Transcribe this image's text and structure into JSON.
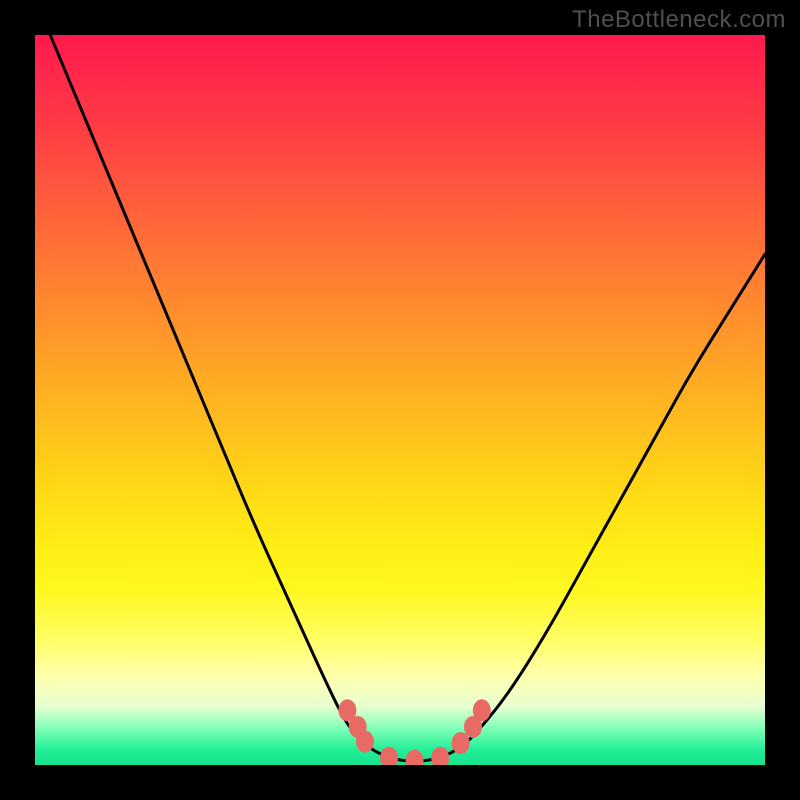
{
  "watermark": "TheBottleneck.com",
  "chart_data": {
    "type": "line",
    "title": "",
    "xlabel": "",
    "ylabel": "",
    "xlim": [
      0,
      1
    ],
    "ylim": [
      0,
      1
    ],
    "series": [
      {
        "name": "bottleneck-curve",
        "x": [
          0.0,
          0.05,
          0.1,
          0.15,
          0.2,
          0.25,
          0.3,
          0.35,
          0.4,
          0.43,
          0.46,
          0.5,
          0.54,
          0.58,
          0.61,
          0.65,
          0.7,
          0.75,
          0.8,
          0.85,
          0.9,
          0.95,
          1.0
        ],
        "y": [
          1.05,
          0.93,
          0.81,
          0.69,
          0.57,
          0.45,
          0.33,
          0.22,
          0.11,
          0.05,
          0.02,
          0.005,
          0.005,
          0.02,
          0.05,
          0.1,
          0.18,
          0.27,
          0.36,
          0.45,
          0.54,
          0.62,
          0.7
        ]
      },
      {
        "name": "segment-markers",
        "points": [
          {
            "x": 0.428,
            "y": 0.075
          },
          {
            "x": 0.442,
            "y": 0.052
          },
          {
            "x": 0.452,
            "y": 0.032
          },
          {
            "x": 0.485,
            "y": 0.01
          },
          {
            "x": 0.52,
            "y": 0.006
          },
          {
            "x": 0.555,
            "y": 0.01
          },
          {
            "x": 0.583,
            "y": 0.03
          },
          {
            "x": 0.6,
            "y": 0.052
          },
          {
            "x": 0.612,
            "y": 0.075
          }
        ]
      }
    ],
    "colors": {
      "curve": "#000000",
      "markers": "#e86a65",
      "gradient_top": "#ff1a4d",
      "gradient_mid": "#ffd815",
      "gradient_bottom": "#18e28e"
    }
  }
}
